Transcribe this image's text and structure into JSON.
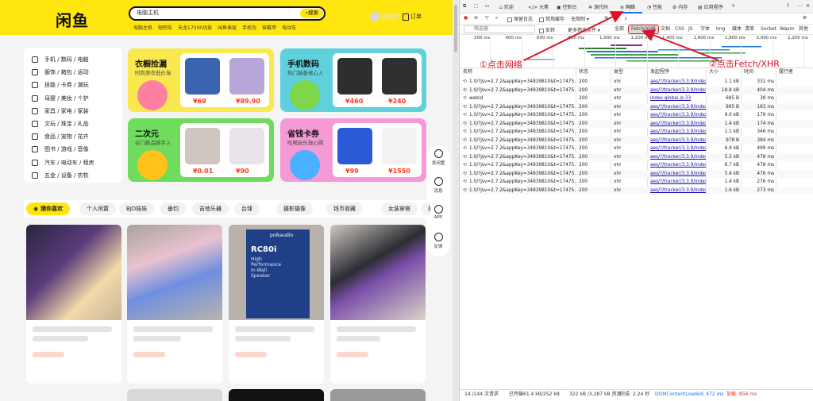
{
  "site": {
    "logo": "闲鱼",
    "search": {
      "value": "电脑主机",
      "button": "搜索"
    },
    "hotwords": [
      "电脑主机",
      "短吧车",
      "天龙1700h功放",
      "闲鱼表层",
      "手机包",
      "穿戴甲",
      "电动车"
    ],
    "orders": "订单",
    "categories": [
      "手机 / 数码 / 电脑",
      "服饰 / 箱包 / 运动",
      "技能 / 卡券 / 潮玩",
      "母婴 / 美妆 / 个护",
      "家具 / 家电 / 家装",
      "文玩 / 珠宝 / 礼品",
      "食品 / 宠物 / 花卉",
      "图书 / 游戏 / 音像",
      "汽车 / 电动车 / 租房",
      "五金 / 设备 / 农牧"
    ],
    "promos": [
      {
        "title": "衣橱捡漏",
        "subtitle": "时尚美衣低价淘",
        "prices": [
          "¥69",
          "¥89.90"
        ]
      },
      {
        "title": "手机数码",
        "subtitle": "热门装备省心入",
        "prices": [
          "¥460",
          "¥240"
        ]
      },
      {
        "title": "二次元",
        "subtitle": "谷门新品随手入",
        "prices": [
          "¥0.01",
          "¥90"
        ]
      },
      {
        "title": "省钱卡券",
        "subtitle": "吃喝玩乐放心购",
        "prices": [
          "¥99",
          "¥1550"
        ]
      }
    ],
    "float_bar": [
      "发闲置",
      "消息",
      "APP",
      "反馈"
    ],
    "feed_tabs": [
      "猜你喜欢",
      "个人闲置",
      "BJD娃娃",
      "垂钓",
      "吉他乐器",
      "台球",
      "摄影摄像",
      "钱币收藏",
      "女装穿搭",
      "居家好物"
    ],
    "product_text": {
      "brand": "polkaudio",
      "model": "RC80i",
      "line1": "High",
      "line2": "Performance",
      "line3": "In-Wall",
      "line4": "Speaker"
    },
    "colors": {
      "brand_yellow": "#ffe60f",
      "price_red": "#ff3b1f"
    }
  },
  "devtools": {
    "tabs": [
      "欢迎",
      "元素",
      "控制台",
      "源代码",
      "网络",
      "性能",
      "内存",
      "应用程序"
    ],
    "active_tab": "网络",
    "toolbar": {
      "preserve_log": "保留日志",
      "disable_cache": "禁用缓存",
      "throttle": "无限制"
    },
    "filter": {
      "placeholder": "筛选器",
      "invert": "反转",
      "more": "更多筛选条件",
      "types": [
        "全部",
        "Fetch/XHR",
        "文档",
        "CSS",
        "JS",
        "字体",
        "Img",
        "媒体",
        "清单",
        "Socket",
        "Wasm",
        "其他"
      ],
      "active_type": "Fetch/XHR"
    },
    "timeline_ticks": [
      "200 ms",
      "400 ms",
      "600 ms",
      "800 ms",
      "1,000 ms",
      "1,200 ms",
      "1,400 ms",
      "1,600 ms",
      "1,800 ms",
      "2,000 ms",
      "2,200 ms"
    ],
    "columns": [
      "名称",
      "状态",
      "类型",
      "发起程序",
      "大小",
      "时间",
      "履行者"
    ],
    "rows": [
      {
        "name": "1.0/?jsv=2.7.2&appKey=34839810&t=17475...",
        "status": "200",
        "type": "xhr",
        "initiator": "aes/?/tracker/3.3.9/index",
        "size": "1.1 kB",
        "time": "331 ms"
      },
      {
        "name": "1.0/?jsv=2.7.2&appKey=34839810&t=17475...",
        "status": "200",
        "type": "xhr",
        "initiator": "aes/?/tracker/3.3.9/index",
        "size": "18.8 kB",
        "time": "404 ms"
      },
      {
        "name": "webid",
        "status": "200",
        "type": "xhr",
        "initiator": "index.global.js:33",
        "size": "695 B",
        "time": "38 ms"
      },
      {
        "name": "1.0/?jsv=2.7.2&appKey=34839810&t=17475...",
        "status": "200",
        "type": "xhr",
        "initiator": "aes/?/tracker/3.3.9/index",
        "size": "995 B",
        "time": "183 ms"
      },
      {
        "name": "1.0/?jsv=2.7.2&appKey=34839810&t=17475...",
        "status": "200",
        "type": "xhr",
        "initiator": "aes/?/tracker/3.3.9/index",
        "size": "9.0 kB",
        "time": "179 ms"
      },
      {
        "name": "1.0/?jsv=2.7.2&appKey=34839810&t=17475...",
        "status": "200",
        "type": "xhr",
        "initiator": "aes/?/tracker/3.3.9/index",
        "size": "1.4 kB",
        "time": "174 ms"
      },
      {
        "name": "1.0/?jsv=2.7.2&appKey=34839810&t=17475...",
        "status": "200",
        "type": "xhr",
        "initiator": "aes/?/tracker/3.3.9/index",
        "size": "1.1 kB",
        "time": "346 ms"
      },
      {
        "name": "1.0/?jsv=2.7.2&appKey=34839810&t=17475...",
        "status": "200",
        "type": "xhr",
        "initiator": "aes/?/tracker/3.3.9/index",
        "size": "978 B",
        "time": "384 ms"
      },
      {
        "name": "1.0/?jsv=2.7.2&appKey=34839810&t=17475...",
        "status": "200",
        "type": "xhr",
        "initiator": "aes/?/tracker/3.3.9/index",
        "size": "6.9 kB",
        "time": "499 ms"
      },
      {
        "name": "1.0/?jsv=2.7.2&appKey=34839810&t=17475...",
        "status": "200",
        "type": "xhr",
        "initiator": "aes/?/tracker/3.3.9/index",
        "size": "5.5 kB",
        "time": "478 ms"
      },
      {
        "name": "1.0/?jsv=2.7.2&appKey=34839810&t=17475...",
        "status": "200",
        "type": "xhr",
        "initiator": "aes/?/tracker/3.3.9/index",
        "size": "6.7 kB",
        "time": "478 ms"
      },
      {
        "name": "1.0/?jsv=2.7.2&appKey=34839810&t=17475...",
        "status": "200",
        "type": "xhr",
        "initiator": "aes/?/tracker/3.3.9/index",
        "size": "5.4 kB",
        "time": "476 ms"
      },
      {
        "name": "1.0/?jsv=2.7.2&appKey=34839810&t=17475...",
        "status": "200",
        "type": "xhr",
        "initiator": "aes/?/tracker/3.3.9/index",
        "size": "1.4 kB",
        "time": "276 ms"
      },
      {
        "name": "1.0/?jsv=2.7.2&appKey=34839810&t=17475...",
        "status": "200",
        "type": "xhr",
        "initiator": "aes/?/tracker/3.3.9/index",
        "size": "1.6 kB",
        "time": "273 ms"
      }
    ],
    "status": {
      "requests": "14 /144 次请求",
      "transferred": "已传输61.4 kB/252 kB",
      "resources": "322 kB /3,287 kB 资源",
      "finish": "完成: 2.24 秒",
      "dcl": "DOMContentLoaded: 472 ms",
      "load": "加载: 856 ms"
    }
  },
  "annotations": {
    "step1": "①点击网络",
    "step2": "②点击Fetch/XHR",
    "color": "#e0102a"
  }
}
